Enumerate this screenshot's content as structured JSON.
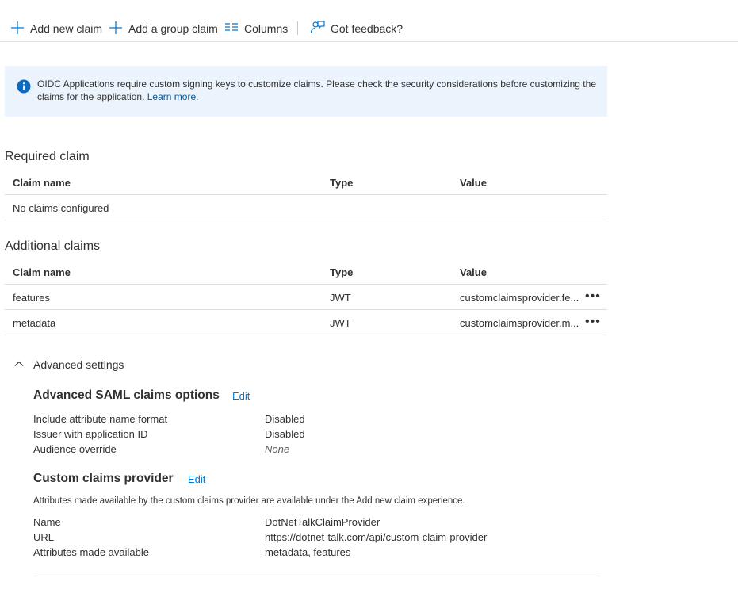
{
  "toolbar": {
    "add_new_claim": "Add new claim",
    "add_group_claim": "Add a group claim",
    "columns": "Columns",
    "got_feedback": "Got feedback?"
  },
  "banner": {
    "message": "OIDC Applications require custom signing keys to customize claims. Please check the security considerations before customizing the claims for the application.",
    "link": "Learn more."
  },
  "required_claim": {
    "title": "Required claim",
    "headers": [
      "Claim name",
      "Type",
      "Value"
    ],
    "empty_text": "No claims configured"
  },
  "additional_claims": {
    "title": "Additional claims",
    "headers": [
      "Claim name",
      "Type",
      "Value"
    ],
    "rows": [
      {
        "name": "features",
        "type": "JWT",
        "value": "customclaimsprovider.fe..."
      },
      {
        "name": "metadata",
        "type": "JWT",
        "value": "customclaimsprovider.m..."
      }
    ],
    "more_glyph": "•••"
  },
  "advanced": {
    "toggle_label": "Advanced settings",
    "saml": {
      "title": "Advanced SAML claims options",
      "edit": "Edit",
      "items": [
        {
          "label": "Include attribute name format",
          "value": "Disabled"
        },
        {
          "label": "Issuer with application ID",
          "value": "Disabled"
        },
        {
          "label": "Audience override",
          "value": "None"
        }
      ]
    },
    "provider": {
      "title": "Custom claims provider",
      "edit": "Edit",
      "note": "Attributes made available by the custom claims provider are available under the Add new claim experience.",
      "items": [
        {
          "label": "Name",
          "value": "DotNetTalkClaimProvider"
        },
        {
          "label": "URL",
          "value": "https://dotnet-talk.com/api/custom-claim-provider"
        },
        {
          "label": "Attributes made available",
          "value": "metadata, features"
        }
      ]
    }
  },
  "colors": {
    "accent": "#0078d4",
    "banner_bg": "#ebf3fc",
    "info_icon": "#0f6cbd"
  }
}
